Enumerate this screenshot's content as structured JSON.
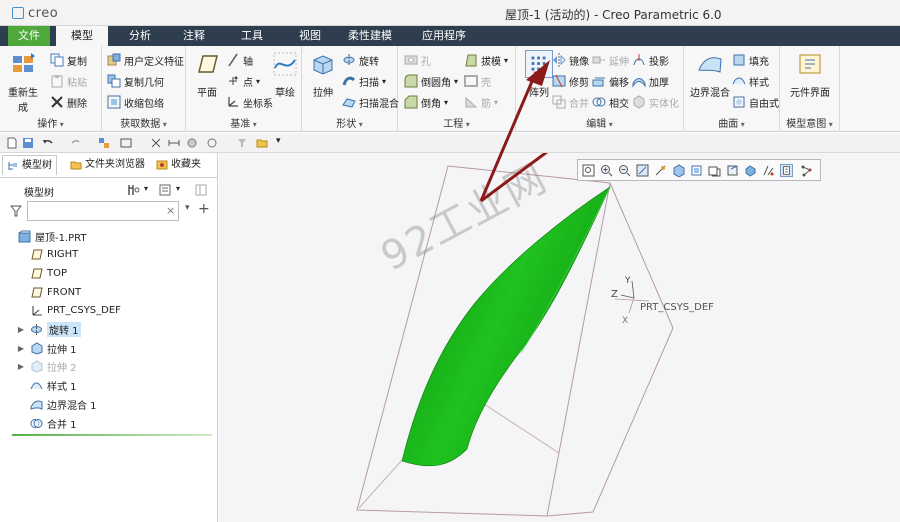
{
  "window": {
    "logo_text": "creo",
    "title": "屋顶-1 (活动的) - Creo Parametric 6.0"
  },
  "menu": {
    "tabs": [
      "文件",
      "模型",
      "分析",
      "注释",
      "工具",
      "视图",
      "柔性建模",
      "应用程序"
    ],
    "active": "模型"
  },
  "ribbon": {
    "groups": {
      "operations": "操作",
      "get_data": "获取数据",
      "datum": "基准",
      "shapes": "形状",
      "engineering": "工程",
      "editing": "编辑",
      "surfaces": "曲面",
      "model_intent": "模型意图"
    },
    "buttons": {
      "regenerate": "重新生成",
      "copy": "复制",
      "paste": "粘贴",
      "delete": "删除",
      "user_defined_feature": "用户定义特征",
      "copy_geometry": "复制几何",
      "shrinkwrap": "收缩包络",
      "plane": "平面",
      "axis": "轴",
      "point": "点",
      "csys": "坐标系",
      "sketch": "草绘",
      "extrude": "拉伸",
      "revolve": "旋转",
      "sweep": "扫描",
      "swept_blend": "扫描混合",
      "hole": "孔",
      "round": "倒圆角",
      "chamfer": "倒角",
      "draft": "拔模",
      "shell": "壳",
      "rib": "筋",
      "pattern": "阵列",
      "mirror": "镜像",
      "trim": "修剪",
      "merge": "合并",
      "extend": "延伸",
      "offset": "偏移",
      "intersect": "相交",
      "project": "投影",
      "thicken": "加厚",
      "solidify": "实体化",
      "boundary_blend": "边界混合",
      "fill": "填充",
      "style": "样式",
      "freestyle": "自由式",
      "component_interface": "元件界面"
    }
  },
  "left_panel": {
    "tabs": [
      "模型树",
      "文件夹浏览器",
      "收藏夹"
    ],
    "tree_title": "模型树",
    "search": {
      "value": "",
      "clear": "×",
      "add": "+"
    },
    "items": [
      {
        "label": "屋顶-1.PRT",
        "icon": "part-icon",
        "expandable": false,
        "state": "normal"
      },
      {
        "label": "RIGHT",
        "icon": "datum-plane-icon",
        "expandable": false,
        "state": "normal"
      },
      {
        "label": "TOP",
        "icon": "datum-plane-icon",
        "expandable": false,
        "state": "normal"
      },
      {
        "label": "FRONT",
        "icon": "datum-plane-icon",
        "expandable": false,
        "state": "normal"
      },
      {
        "label": "PRT_CSYS_DEF",
        "icon": "csys-icon",
        "expandable": false,
        "state": "normal"
      },
      {
        "label": "旋转 1",
        "icon": "revolve-icon",
        "expandable": true,
        "state": "selected"
      },
      {
        "label": "拉伸 1",
        "icon": "extrude-icon",
        "expandable": true,
        "state": "normal"
      },
      {
        "label": "拉伸 2",
        "icon": "extrude-icon",
        "expandable": true,
        "state": "suppressed"
      },
      {
        "label": "样式 1",
        "icon": "style-icon",
        "expandable": false,
        "state": "normal"
      },
      {
        "label": "边界混合 1",
        "icon": "boundary-blend-icon",
        "expandable": false,
        "state": "normal"
      },
      {
        "label": "合并 1",
        "icon": "merge-icon",
        "expandable": false,
        "state": "normal"
      }
    ]
  },
  "graphics": {
    "watermark": "92工业网",
    "csys_label": "PRT_CSYS_DEF",
    "axis_labels": {
      "x": "X",
      "y": "Y",
      "z": "Z"
    }
  },
  "colors": {
    "file_tab": "#4ea83a",
    "menu_bar": "#2f3e4e",
    "surface_green": "#1fb81f",
    "arrow": "#8b1a1a",
    "selection": "#cce4f7"
  }
}
